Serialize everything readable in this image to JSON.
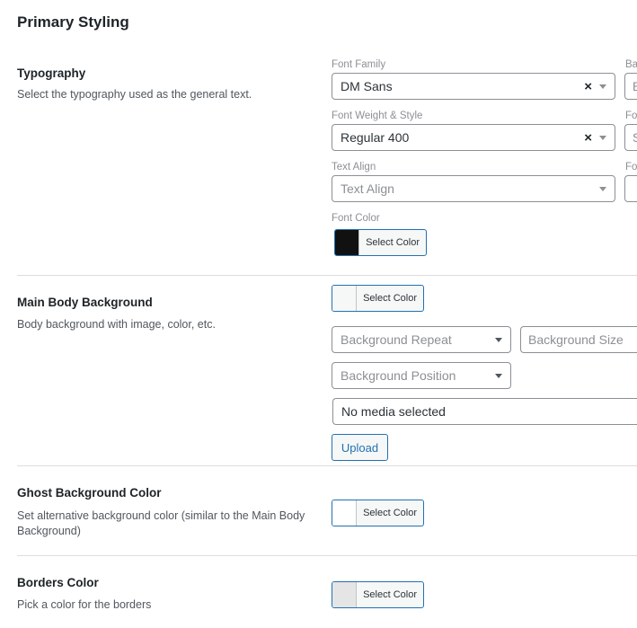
{
  "page_title": "Primary Styling",
  "typography": {
    "title": "Typography",
    "description": "Select the typography used as the general text.",
    "font_family": {
      "label": "Font Family",
      "value": "DM Sans"
    },
    "font_weight": {
      "label": "Font Weight & Style",
      "value": "Regular 400"
    },
    "text_align": {
      "label": "Text Align",
      "placeholder": "Text Align"
    },
    "font_color": {
      "label": "Font Color",
      "button_label": "Select Color",
      "color": "#111111"
    },
    "right_col": {
      "label_1": "Ba",
      "input_1": "B",
      "label_2": "Fo",
      "input_2": "S",
      "label_3": "Fo"
    }
  },
  "main_body_background": {
    "title": "Main Body Background",
    "description": "Body background with image, color, etc.",
    "color": {
      "button_label": "Select Color",
      "color": "#f6f7f7"
    },
    "background_repeat": {
      "placeholder": "Background Repeat"
    },
    "background_size": {
      "placeholder": "Background Size"
    },
    "background_position": {
      "placeholder": "Background Position"
    },
    "media": {
      "value": "No media selected",
      "upload_label": "Upload"
    }
  },
  "ghost_background": {
    "title": "Ghost Background Color",
    "description": "Set alternative background color (similar to the Main Body Background)",
    "color": {
      "button_label": "Select Color",
      "color": "#ffffff"
    }
  },
  "borders_color": {
    "title": "Borders Color",
    "description": "Pick a color for the borders",
    "color": {
      "button_label": "Select Color",
      "color": "#e5e5e5"
    }
  },
  "colors": {
    "accent": "#2271b1",
    "border": "#8c8f94",
    "divider": "#dcdcde"
  }
}
